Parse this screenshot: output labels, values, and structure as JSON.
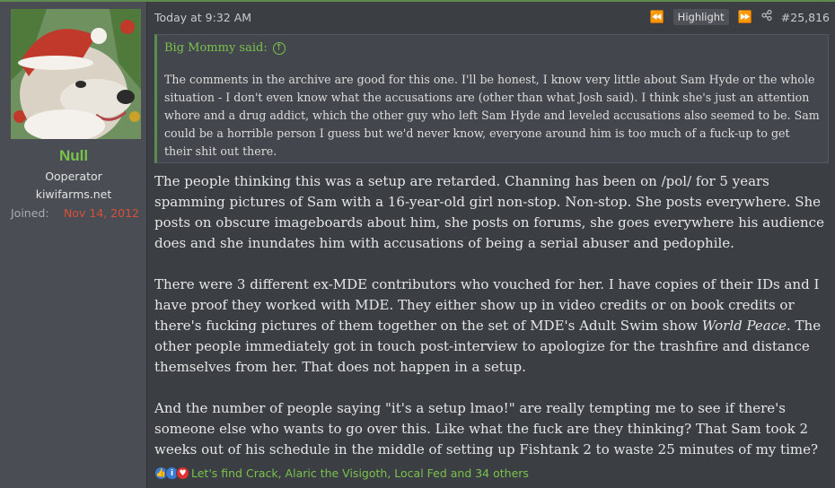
{
  "user": {
    "name": "Null",
    "title": "Ooperator",
    "banner": "kiwifarms.net",
    "joined_label": "Joined:",
    "joined_value": "Nov 14, 2012"
  },
  "post": {
    "timestamp": "Today at 9:32 AM",
    "highlight_label": "Highlight",
    "post_number": "#25,816",
    "quote": {
      "author": "Big Mommy said:",
      "text": "The comments in the archive are good for this one. I'll be honest, I know very little about Sam Hyde or the whole situation - I don't even know what the accusations are (other than what Josh said). I think she's just an attention whore and a drug addict, which the other guy who left Sam Hyde and leveled accusations also seemed to be. Sam could be a horrible person I guess but we'd never know, everyone around him is too much of a fuck-up to get their shit out there."
    },
    "paragraphs": {
      "p1": "The people thinking this was a setup are retarded. Channing has been on /pol/ for 5 years spamming pictures of Sam with a 16-year-old girl non-stop. Non-stop. She posts everywhere. She posts on obscure imageboards about him, she posts on forums, she goes everywhere his audience does and she inundates him with accusations of being a serial abuser and pedophile.",
      "p2_before": "There were 3 different ex-MDE contributors who vouched for her. I have copies of their IDs and I have proof they worked with MDE. They either show up in video credits or on book credits or there's fucking pictures of them together on the set of MDE's Adult Swim show ",
      "p2_italic": "World Peace",
      "p2_after": ". The other people immediately got in touch post-interview to apologize for the trashfire and distance themselves from her. That does not happen in a setup.",
      "p3": "And the number of people saying \"it's a setup lmao!\" are really tempting me to see if there's someone else who wants to go over this. Like what the fuck are they thinking? That Sam took 2 weeks out of his schedule in the middle of setting up Fishtank 2 to waste 25 minutes of my time?"
    },
    "reactions_text": "Let's find Crack, Alaric the Visigoth, Local Fed and 34 others"
  },
  "colors": {
    "accent_green": "#7bc24c",
    "joined_red": "#d94f3a",
    "background": "#3b3e43"
  },
  "icons": [
    "first-post-icon",
    "last-post-icon",
    "share-icon",
    "quote-jump-icon",
    "like-reaction-icon",
    "informative-reaction-icon",
    "love-reaction-icon"
  ]
}
